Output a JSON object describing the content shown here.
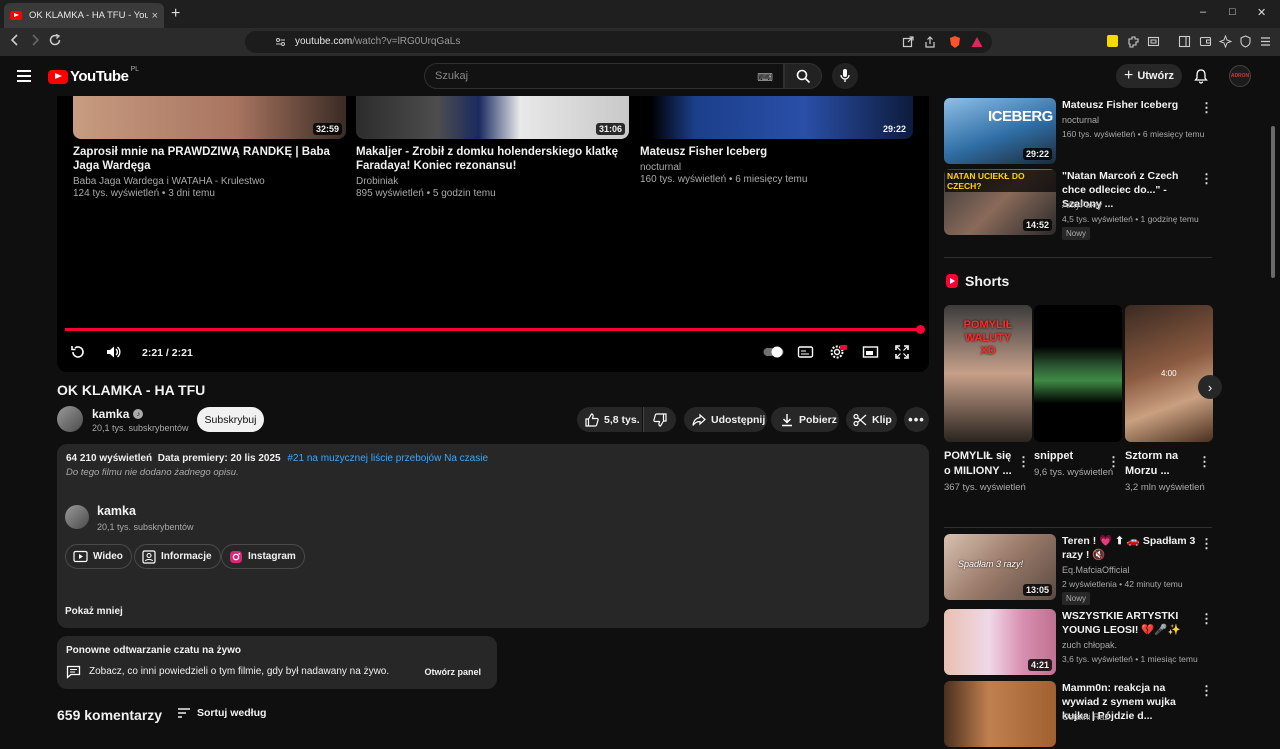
{
  "browser": {
    "tab_title": "OK KLAMKA - HA TFU - YouTube",
    "tab_close": "×",
    "new_tab": "+",
    "url_host": "youtube.com",
    "url_path": "/watch?v=lRG0UrqGaLs",
    "win_min": "–",
    "win_max": "□",
    "win_close": "✕"
  },
  "header": {
    "logo_text": "YouTube",
    "country": "PL",
    "search_placeholder": "Szukaj",
    "create_label": "Utwórz",
    "avatar_text": "ADRON"
  },
  "player": {
    "timecode": "2:21 / 2:21",
    "progress_fraction": 1.0,
    "endcards": [
      {
        "title": "Zaprosił mnie na PRAWDZIWĄ RANDKĘ | Baba Jaga Wardęga",
        "channel": "Baba Jaga Wardega i WATAHA - Krulestwo",
        "meta": "124 tys. wyświetleń • 3 dni temu",
        "duration": "32:59"
      },
      {
        "title": "Makaljer - Zrobił z domku holenderskiego klatkę Faradaya! Koniec rezonansu!",
        "channel": "Drobiniak",
        "meta": "895 wyświetleń • 5 godzin temu",
        "duration": "31:06"
      },
      {
        "title": "Mateusz Fisher Iceberg",
        "channel": "nocturnal",
        "meta": "160 tys. wyświetleń • 6 miesięcy temu",
        "duration": "29:22"
      }
    ]
  },
  "video": {
    "title": "OK KLAMKA - HA TFU",
    "channel": "kamka",
    "subs": "20,1 tys. subskrybentów",
    "subscribe_label": "Subskrybuj",
    "likes": "5,8 tys.",
    "share_label": "Udostępnij",
    "download_label": "Pobierz",
    "clip_label": "Klip"
  },
  "description": {
    "views": "64 210 wyświetleń",
    "premiere": "Data premiery: 20 lis 2025",
    "tag": "#21 na muzycznej liście przebojów Na czasie",
    "no_desc": "Do tego filmu nie dodano żadnego opisu.",
    "channel": "kamka",
    "subs": "20,1 tys. subskrybentów",
    "links": [
      "Wideo",
      "Informacje",
      "Instagram"
    ],
    "show_less": "Pokaż mniej"
  },
  "chat": {
    "title": "Ponowne odtwarzanie czatu na żywo",
    "desc": "Zobacz, co inni powiedzieli o tym filmie, gdy był nadawany na żywo.",
    "button": "Otwórz panel"
  },
  "comments": {
    "count": "659 komentarzy",
    "sort": "Sortuj według"
  },
  "sidebar": {
    "top": [
      {
        "title": "Mateusz Fisher Iceberg",
        "channel": "nocturnal",
        "meta": "160 tys. wyświetleń • 6 miesięcy temu",
        "duration": "29:22",
        "thumb_text": "ICEBERG"
      },
      {
        "title": "\"Natan Marcoń z Czech chce odleciec do...\" - Szalony ...",
        "channel": "AntyFakty",
        "meta": "4,5 tys. wyświetleń • 1 godzinę temu",
        "duration": "14:52",
        "badge": "Nowy",
        "thumb_text": "NATAN UCIEKŁ DO CZECH?"
      }
    ],
    "shorts_title": "Shorts",
    "shorts": [
      {
        "title": "POMYLIŁ się o MILIONY ...",
        "views": "367 tys. wyświetleń",
        "thumb_text": "POMYLIŁ WALUTY XD"
      },
      {
        "title": "snippet",
        "views": "9,6 tys. wyświetleń"
      },
      {
        "title": "Sztorm na Morzu ...",
        "views": "3,2 mln wyświetleń",
        "thumb_text": "4:00"
      }
    ],
    "bottom": [
      {
        "title": "Teren ! 💗 ⬆ 🚗 Spadłam 3 razy ! 🔇",
        "channel": "Eq.MafciaOfficial",
        "meta": "2 wyświetlenia • 42 minuty temu",
        "duration": "13:05",
        "badge": "Nowy",
        "thumb_text": "Spadłam 3 razy!"
      },
      {
        "title": "WSZYSTKIE ARTYSTKI YOUNG LEOSI! 💔🎤✨",
        "channel": "zuch chłopak.",
        "meta": "3,6 tys. wyświetleń • 1 miesiąc temu",
        "duration": "4:21"
      },
      {
        "title": "Mamm0n: reakcja na wywiad z synem wujka kujka | Pójdzie d...",
        "channel": "Ostatni Raz"
      }
    ]
  },
  "colors": {
    "accent": "#ff0033",
    "link": "#3ea6ff",
    "background": "#0f0f0f"
  }
}
